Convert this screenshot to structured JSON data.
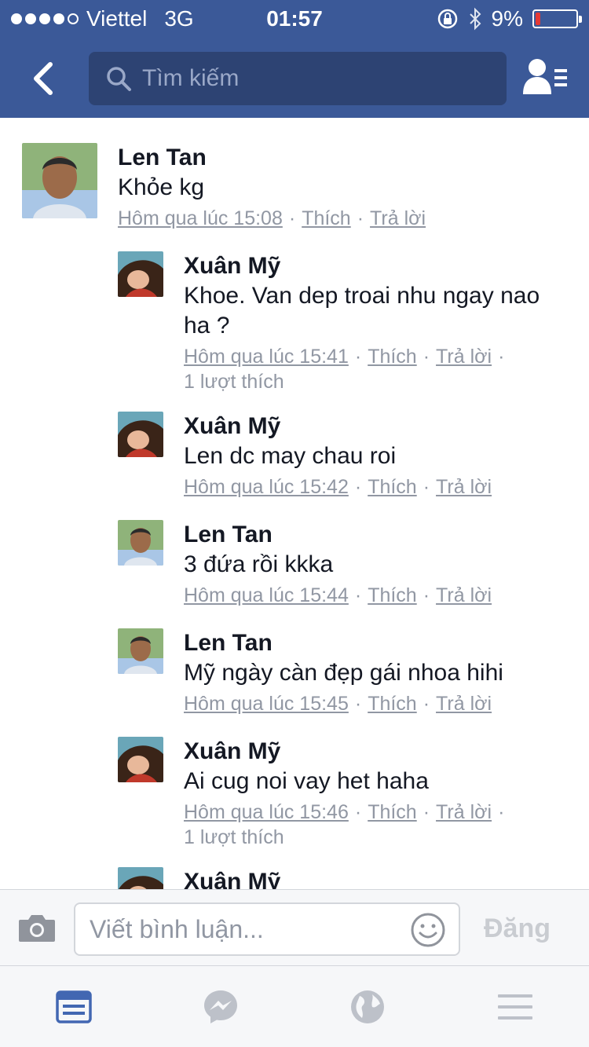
{
  "status_bar": {
    "carrier": "Viettel",
    "network": "3G",
    "time": "01:57",
    "battery": "9%"
  },
  "nav": {
    "search_placeholder": "Tìm kiếm"
  },
  "comments": [
    {
      "name": "Len Tan",
      "text": "Khỏe kg",
      "time": "Hôm qua lúc 15:08",
      "like": "Thích",
      "reply": "Trả lời",
      "likes": ""
    },
    {
      "name": "Xuân Mỹ",
      "text": "Khoe. Van dep troai nhu ngay nao ha ?",
      "time": "Hôm qua lúc 15:41",
      "like": "Thích",
      "reply": "Trả lời",
      "likes": "1 lượt thích"
    },
    {
      "name": "Xuân Mỹ",
      "text": "Len dc may chau roi",
      "time": "Hôm qua lúc 15:42",
      "like": "Thích",
      "reply": "Trả lời",
      "likes": ""
    },
    {
      "name": "Len Tan",
      "text": "3 đứa rồi kkka",
      "time": "Hôm qua lúc 15:44",
      "like": "Thích",
      "reply": "Trả lời",
      "likes": ""
    },
    {
      "name": "Len Tan",
      "text": "Mỹ ngày càn đẹp gái nhoa hihi",
      "time": "Hôm qua lúc 15:45",
      "like": "Thích",
      "reply": "Trả lời",
      "likes": ""
    },
    {
      "name": "Xuân Mỹ",
      "text": "Ai cug noi vay het haha",
      "time": "Hôm qua lúc 15:46",
      "like": "Thích",
      "reply": "Trả lời",
      "likes": "1 lượt thích"
    },
    {
      "name": "Xuân Mỹ"
    }
  ],
  "composer": {
    "placeholder": "Viết bình luận...",
    "post_label": "Đăng"
  },
  "colors": {
    "brand": "#3b5998",
    "search_bg": "#2d4373",
    "meta_text": "#9197a3",
    "active_tab": "#4267b2",
    "inactive_tab": "#bdc1c9",
    "battery_low": "#e53935"
  },
  "icons": {
    "back": "chevron-left-icon",
    "search": "search-icon",
    "friends": "friend-requests-icon",
    "camera": "camera-icon",
    "emoji": "emoji-icon",
    "tabs": [
      "news-feed-icon",
      "messenger-icon",
      "globe-icon",
      "menu-icon"
    ]
  }
}
